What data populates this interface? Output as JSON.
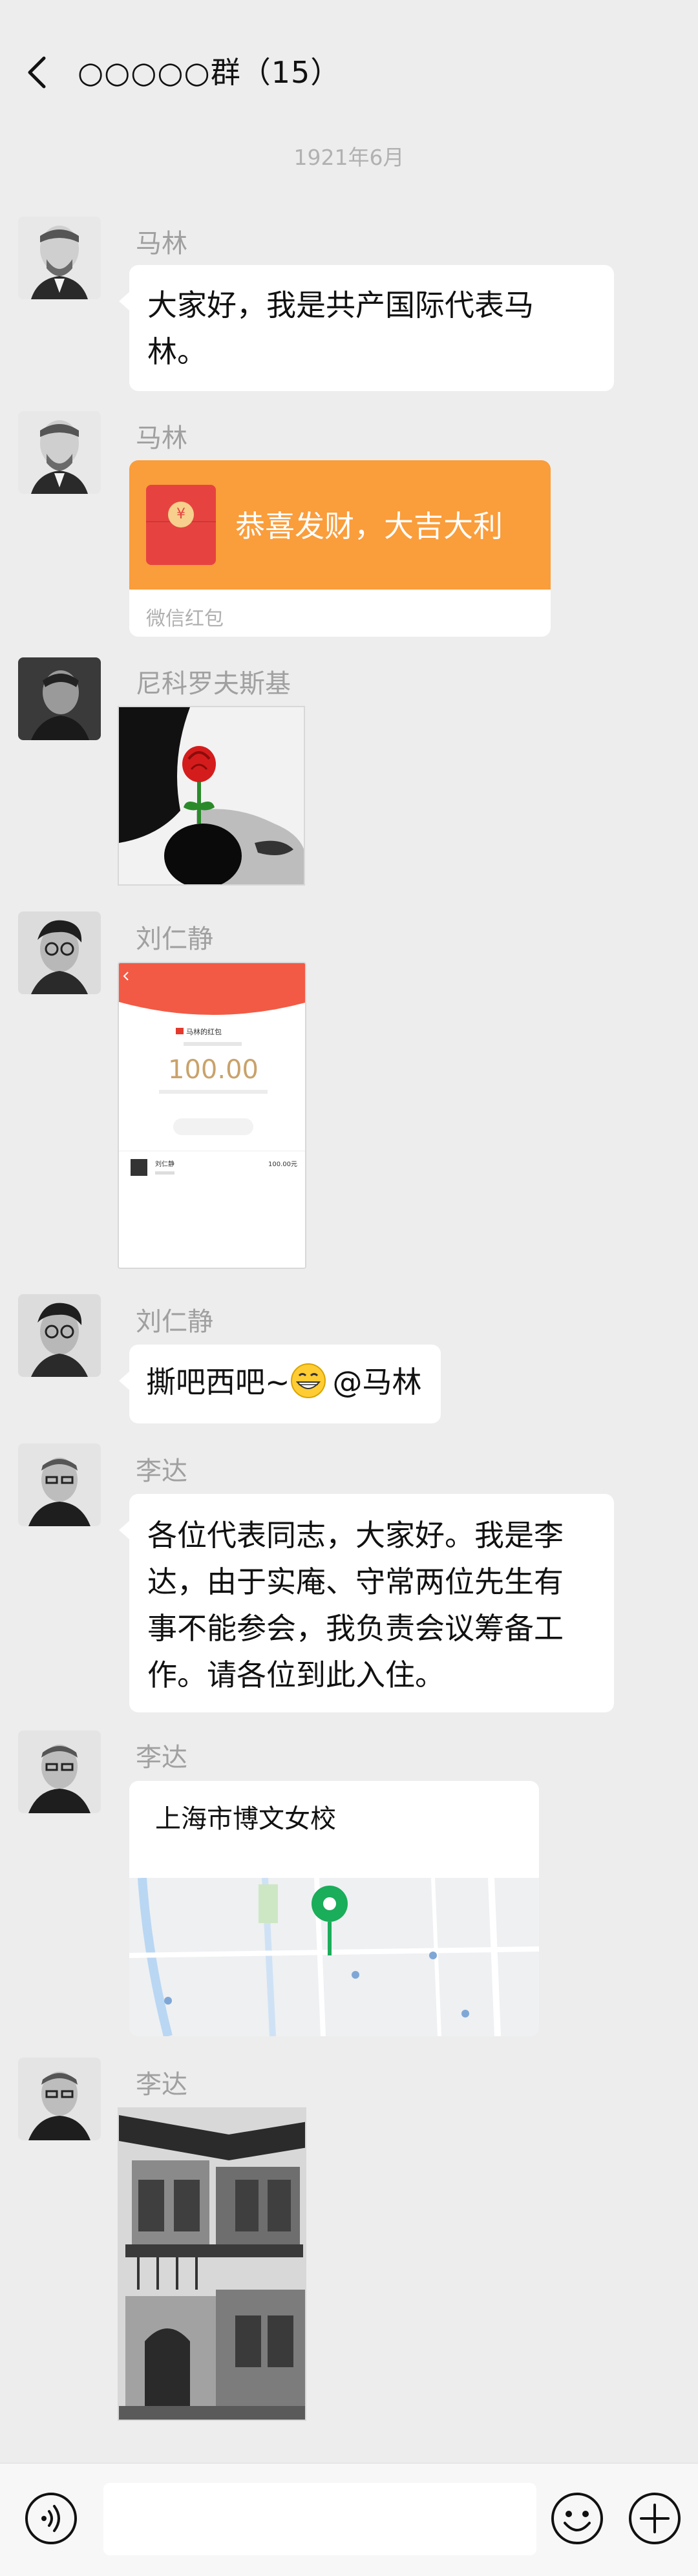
{
  "header": {
    "title": "○○○○○群（15）"
  },
  "date_divider": "1921年6月",
  "messages": [
    {
      "sender": "马林",
      "text_line1": "大家好，我是共产国际代表马",
      "text_line2": "林。"
    },
    {
      "sender": "马林",
      "red_packet_text": "恭喜发财，大吉大利",
      "red_packet_label": "微信红包"
    },
    {
      "sender": "尼科罗夫斯基"
    },
    {
      "sender": "刘仁静",
      "screenshot": {
        "title": "马林的红包",
        "amount": "100.00",
        "payer": "刘仁静",
        "payer_amount": "100.00元"
      }
    },
    {
      "sender": "刘仁静",
      "text_prefix": "撕吧西吧~",
      "text_mention": "@马林"
    },
    {
      "sender": "李达",
      "lines": [
        "各位代表同志，大家好。我是李",
        "达，由于实庵、守常两位先生有",
        "事不能参会，我负责会议筹备工",
        "作。请各位到此入住。"
      ]
    },
    {
      "sender": "李达",
      "location_title": "上海市博文女校"
    },
    {
      "sender": "李达"
    }
  ],
  "colors": {
    "background": "#ededed",
    "bubble": "#ffffff",
    "red_packet": "#fa9d3b",
    "pin": "#1aad5a"
  }
}
